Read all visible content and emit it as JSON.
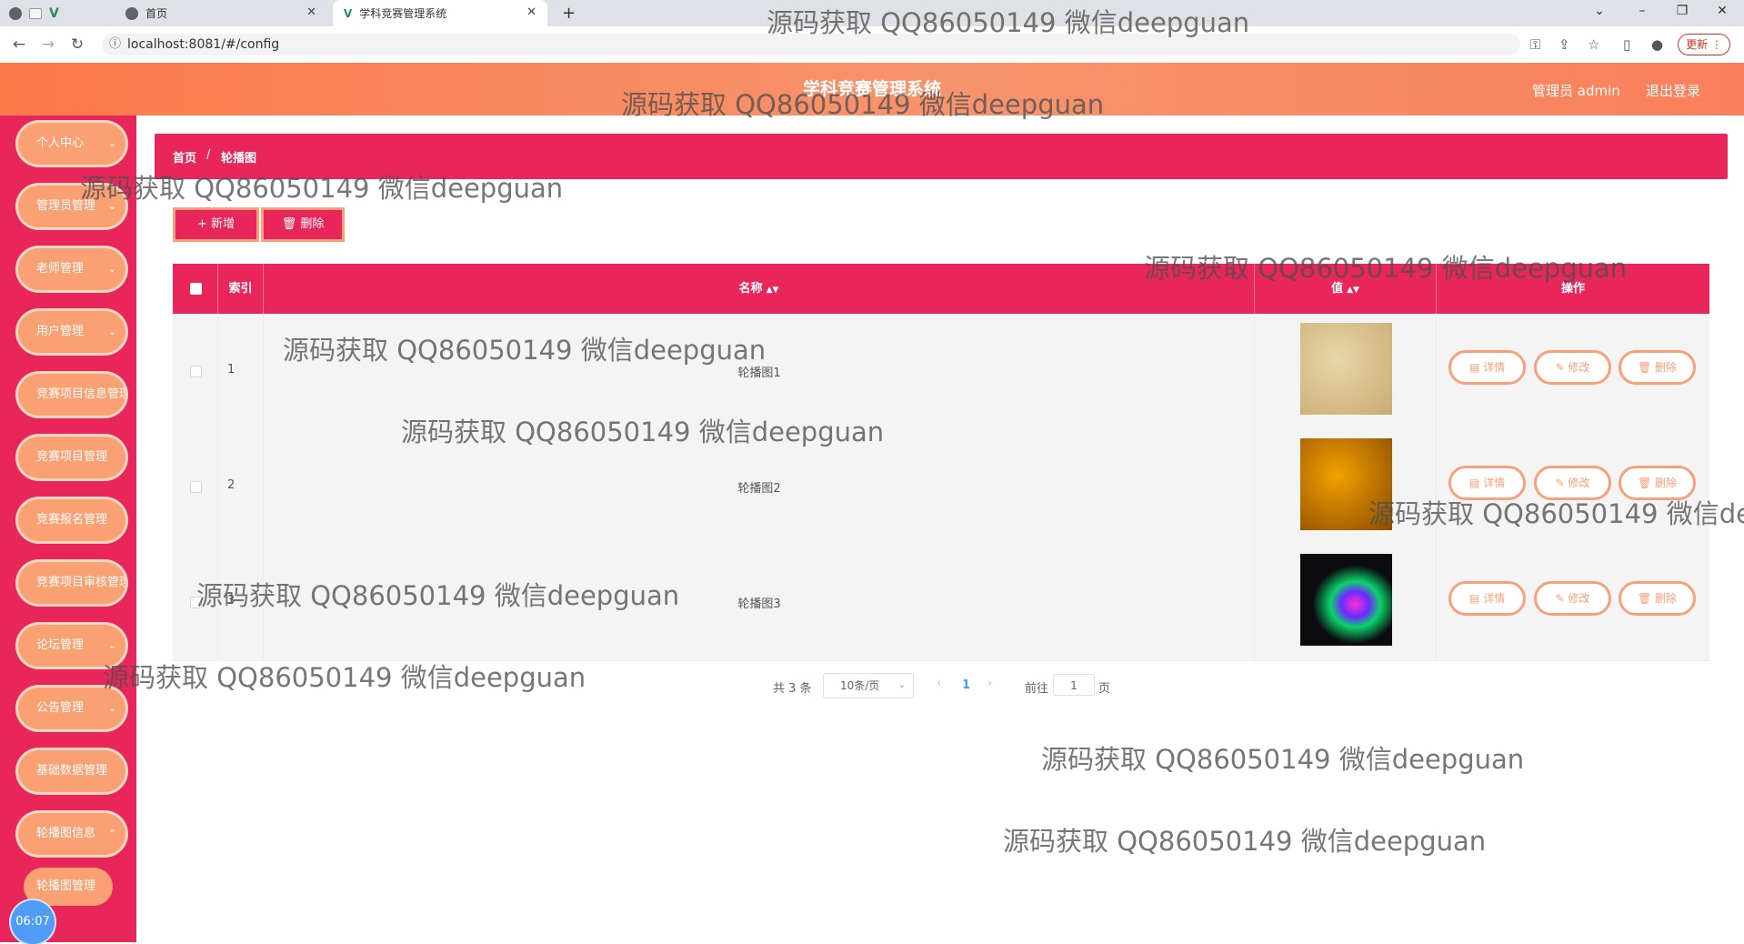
{
  "browser": {
    "tabs": [
      {
        "title": "首页",
        "active": false
      },
      {
        "title": "学科竞赛管理系统",
        "active": true
      }
    ],
    "new_tab": "+",
    "close_glyph": "✕",
    "url": "localhost:8081/#/config",
    "update_label": "更新",
    "icons": [
      "back-icon",
      "forward-icon",
      "reload-icon",
      "info-icon",
      "key-icon",
      "share-icon",
      "star-icon",
      "sidepanel-icon",
      "profile-icon",
      "menu-icon",
      "minimize-icon",
      "restore-icon",
      "close-icon"
    ]
  },
  "header": {
    "title": "学科竞赛管理系统",
    "admin": "管理员 admin",
    "logout": "退出登录"
  },
  "sidebar": {
    "items": [
      {
        "label": "个人中心"
      },
      {
        "label": "管理员管理"
      },
      {
        "label": "老师管理"
      },
      {
        "label": "用户管理"
      },
      {
        "label": "竞赛项目信息管理"
      },
      {
        "label": "竞赛项目管理"
      },
      {
        "label": "竞赛报名管理"
      },
      {
        "label": "竞赛项目审核管理"
      },
      {
        "label": "论坛管理"
      },
      {
        "label": "公告管理"
      },
      {
        "label": "基础数据管理"
      },
      {
        "label": "轮播图信息"
      }
    ],
    "submenu": "轮播图管理",
    "clock": "06:07"
  },
  "breadcrumb": {
    "home": "首页",
    "separator": "/",
    "current": "轮播图"
  },
  "actions": {
    "add": "+ 新增",
    "delete": "删除"
  },
  "table": {
    "headers": {
      "index": "索引",
      "name": "名称",
      "value": "值",
      "ops": "操作"
    },
    "rows": [
      {
        "index": "1",
        "name": "轮播图1",
        "thumb_colors": [
          "#e8d6a8",
          "#c9ab72"
        ]
      },
      {
        "index": "2",
        "name": "轮播图2",
        "thumb_colors": [
          "#f2a100",
          "#8a4a00"
        ]
      },
      {
        "index": "3",
        "name": "轮播图3",
        "thumb_colors": [
          "#0b0b10",
          "#6a2cff"
        ]
      }
    ],
    "op_labels": {
      "detail": "详情",
      "edit": "修改",
      "delete": "删除"
    }
  },
  "pagination": {
    "total": "共 3 条",
    "page_size": "10条/页",
    "current": "1",
    "goto": "前往",
    "goto_value": "1",
    "unit": "页"
  },
  "watermark": "源码获取 QQ86050149 微信deepguan",
  "colors": {
    "primary": "#e8265a",
    "accent": "#f9a172",
    "header_from": "#fb7a4a",
    "header_to": "#f9805a"
  }
}
